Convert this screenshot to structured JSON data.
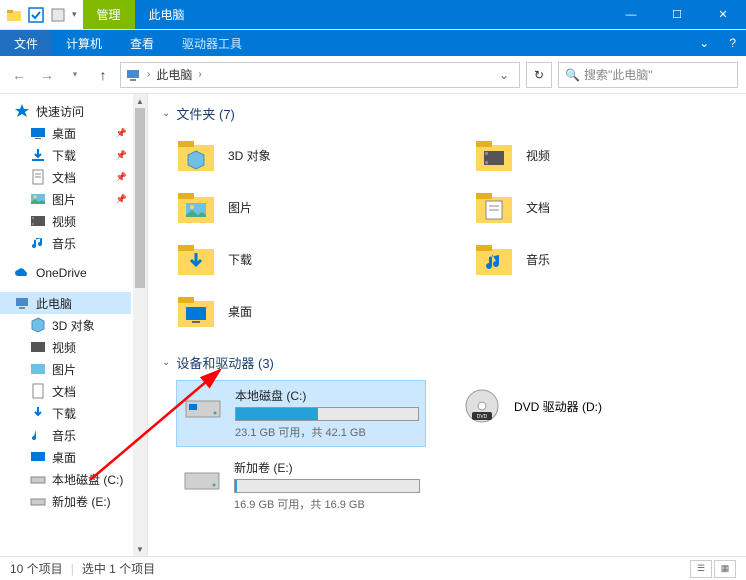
{
  "titlebar": {
    "manage_tab": "管理",
    "thispc_tab": "此电脑",
    "min": "—",
    "max": "☐",
    "close": "✕"
  },
  "ribbon": {
    "file": "文件",
    "computer": "计算机",
    "view": "查看",
    "drive_tools": "驱动器工具",
    "help": "?"
  },
  "nav": {
    "back": "←",
    "fwd": "→",
    "down": "▾",
    "up": "↑",
    "crumb_sep": "›",
    "location": "此电脑",
    "drop": "⌄",
    "refresh": "↻",
    "search_icon": "🔍",
    "search_placeholder": "搜索\"此电脑\""
  },
  "tree": {
    "quick": "快速访问",
    "desktop": "桌面",
    "downloads": "下载",
    "documents": "文档",
    "pictures": "图片",
    "videos": "视频",
    "music": "音乐",
    "onedrive": "OneDrive",
    "thispc": "此电脑",
    "obj3d": "3D 对象",
    "localc": "本地磁盘 (C:)",
    "vole": "新加卷 (E:)"
  },
  "sections": {
    "folders": "文件夹 (7)",
    "drives": "设备和驱动器 (3)"
  },
  "folders": {
    "obj3d": "3D 对象",
    "videos": "视频",
    "pictures": "图片",
    "documents": "文档",
    "downloads": "下载",
    "music": "音乐",
    "desktop": "桌面"
  },
  "drives": {
    "c": {
      "name": "本地磁盘 (C:)",
      "stat": "23.1 GB 可用，共 42.1 GB",
      "fill_pct": 45
    },
    "e": {
      "name": "新加卷 (E:)",
      "stat": "16.9 GB 可用，共 16.9 GB",
      "fill_pct": 1
    },
    "dvd": {
      "name": "DVD 驱动器 (D:)"
    }
  },
  "status": {
    "items": "10 个项目",
    "selected": "选中 1 个项目"
  }
}
